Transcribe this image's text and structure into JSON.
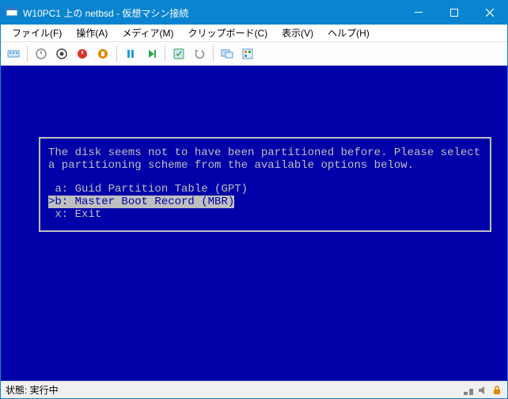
{
  "window": {
    "title": "W10PC1 上の netbsd - 仮想マシン接続"
  },
  "menu": {
    "file": "ファイル(F)",
    "action": "操作(A)",
    "media": "メディア(M)",
    "clipboard": "クリップボード(C)",
    "view": "表示(V)",
    "help": "ヘルプ(H)"
  },
  "dialog": {
    "message_line1": "The disk seems not to have been partitioned before. Please select",
    "message_line2": "a partitioning scheme from the available options below.",
    "opt_a": "a: Guid Partition Table (GPT)",
    "opt_b": "b: Master Boot Record (MBR)",
    "opt_x": "x: Exit",
    "selected_index": 1
  },
  "status": {
    "label": "状態: 実行中"
  },
  "colors": {
    "console_bg": "#0000a8",
    "console_fg": "#bfbfbf",
    "titlebar_bg": "#0a84d0"
  }
}
